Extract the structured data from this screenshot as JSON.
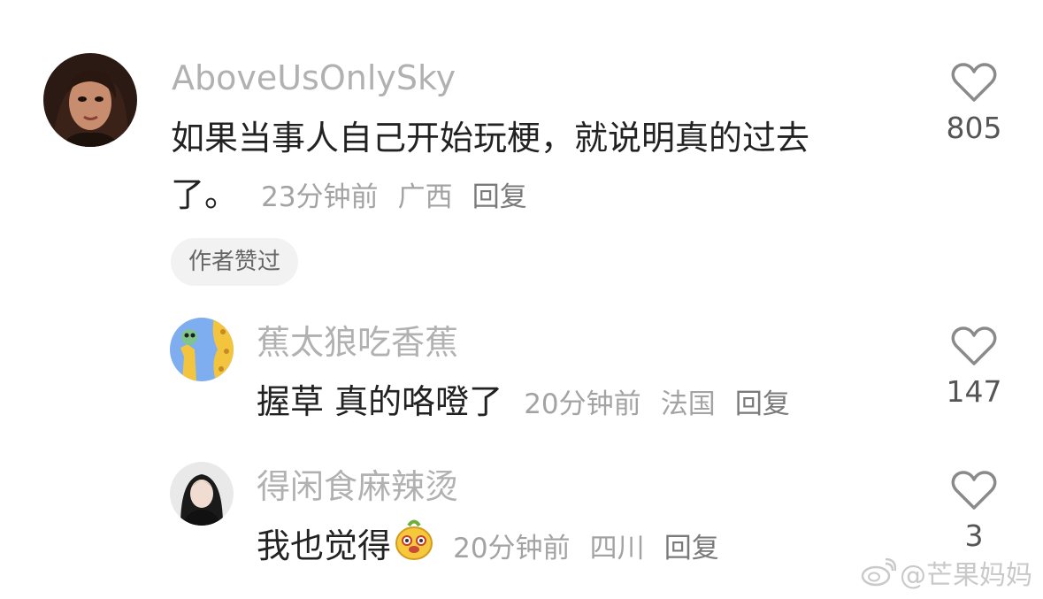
{
  "comments": [
    {
      "username": "AboveUsOnlySky",
      "text_line1": "如果当事人自己开始玩梗，就说明真的过去",
      "text_line2": "了。",
      "time": "23分钟前",
      "location": "广西",
      "reply_label": "回复",
      "likes": "805",
      "badge": "作者赞过"
    },
    {
      "username": "蕉太狼吃香蕉",
      "text": "握草 真的咯噔了",
      "time": "20分钟前",
      "location": "法国",
      "reply_label": "回复",
      "likes": "147"
    },
    {
      "username": "得闲食麻辣烫",
      "text": "我也觉得",
      "time": "20分钟前",
      "location": "四川",
      "reply_label": "回复",
      "likes": "3"
    }
  ],
  "watermark": "@芒果妈妈",
  "icons": {
    "like": "heart-outline-icon",
    "emoji": "smiling-face-emoji",
    "watermark": "weibo-icon"
  },
  "colors": {
    "username": "#b1b1b1",
    "meta": "#a3a3a3",
    "text": "#222222",
    "badge_bg": "#f2f2f2"
  }
}
